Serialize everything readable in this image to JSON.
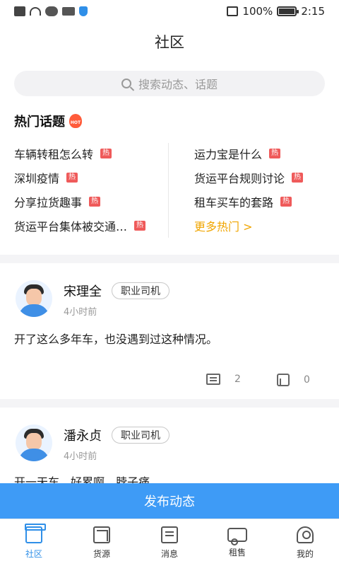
{
  "status_bar": {
    "battery_text": "100%",
    "time": "2:15",
    "battery_level": 1.0
  },
  "header": {
    "title": "社区"
  },
  "search": {
    "placeholder": "搜索动态、话题"
  },
  "hot_topics": {
    "title": "热门话题",
    "hot_icon_text": "HOT",
    "left": [
      {
        "label": "车辆转租怎么转",
        "badge": "热"
      },
      {
        "label": "深圳疫情",
        "badge": "热"
      },
      {
        "label": "分享拉货趣事",
        "badge": "热"
      },
      {
        "label": "货运平台集体被交通…",
        "badge": "热"
      }
    ],
    "right": [
      {
        "label": "运力宝是什么",
        "badge": "热"
      },
      {
        "label": "货运平台规则讨论",
        "badge": "热"
      },
      {
        "label": "租车买车的套路",
        "badge": "热"
      }
    ],
    "more": "更多热门 >"
  },
  "posts": [
    {
      "name": "宋理全",
      "role": "职业司机",
      "time": "4小时前",
      "content": "开了这么多年车，也没遇到过这种情况。",
      "comments": "2",
      "likes": "0"
    },
    {
      "name": "潘永贞",
      "role": "职业司机",
      "time": "4小时前",
      "content": "开一天车，好累啊，脖子痛。"
    }
  ],
  "publish_button": "发布动态",
  "tabs": [
    {
      "label": "社区",
      "icon": "community-icon",
      "active": true
    },
    {
      "label": "货源",
      "icon": "cargo-icon"
    },
    {
      "label": "消息",
      "icon": "message-icon"
    },
    {
      "label": "租售",
      "icon": "truck-icon"
    },
    {
      "label": "我的",
      "icon": "profile-icon"
    }
  ],
  "colors": {
    "accent": "#3e9bf6",
    "hot_badge": "#ef5a5a",
    "more_hot": "#f0a500"
  }
}
